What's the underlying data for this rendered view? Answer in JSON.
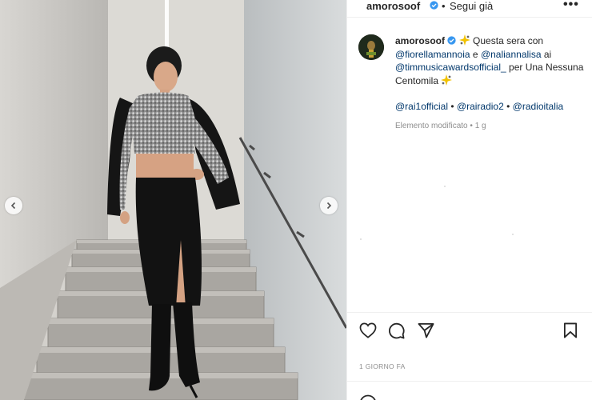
{
  "post": {
    "username": "amorosoof",
    "separator": "•",
    "follow_label": "Segui già",
    "more_label": "•••",
    "caption": {
      "username": "amorosoof",
      "text_1": "Questa sera con",
      "mention_1": "@fiorellamannoia",
      "and": "e",
      "mention_2": "@naliannalisa",
      "ai": "ai",
      "mention_3": "@timmusicawardsofficial_",
      "text_2": "per Una Nessuna Centomila",
      "mention_4": "@rai1official",
      "mention_5": "@rairadio2",
      "mention_6": "@radioitalia",
      "bullet": "•",
      "edited": "Elemento modificato",
      "age": "1 g"
    },
    "timestamp": "1 GIORNO FA"
  },
  "icons": {
    "verified": "verified-badge-icon",
    "like": "heart-icon",
    "comment": "comment-icon",
    "share": "paper-plane-icon",
    "save": "bookmark-icon",
    "emoji": "sparkle-emoji-icon",
    "prev": "chevron-left-icon",
    "next": "chevron-right-icon"
  },
  "colors": {
    "verified": "#3897f0",
    "mention": "#00376b",
    "muted": "#8e8e8e",
    "text": "#262626"
  }
}
